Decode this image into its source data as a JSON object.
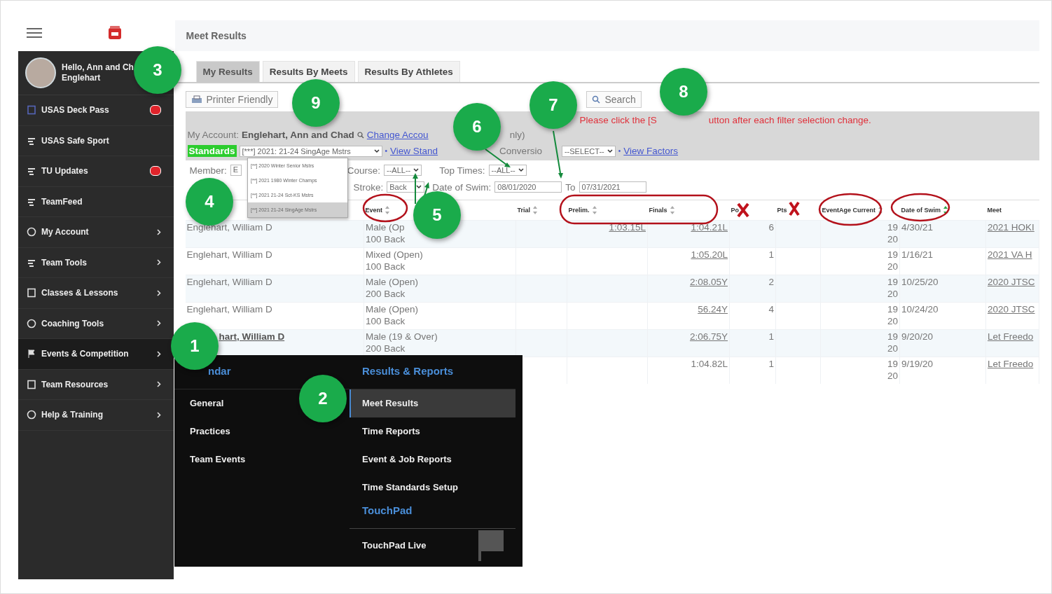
{
  "header": {
    "title": "Meet Results"
  },
  "user": {
    "greeting": "Hello, Ann and Ch",
    "name": "Englehart"
  },
  "sidebar": {
    "items": [
      {
        "label": "USAS Deck Pass",
        "badge": true,
        "submenu": false,
        "selected": false
      },
      {
        "label": "USAS Safe Sport",
        "badge": false,
        "submenu": false,
        "selected": false
      },
      {
        "label": "TU Updates",
        "badge": true,
        "submenu": false,
        "selected": false
      },
      {
        "label": "TeamFeed",
        "badge": false,
        "submenu": false,
        "selected": false
      },
      {
        "label": "My Account",
        "badge": false,
        "submenu": true,
        "selected": false
      },
      {
        "label": "Team Tools",
        "badge": false,
        "submenu": true,
        "selected": false
      },
      {
        "label": "Classes & Lessons",
        "badge": false,
        "submenu": true,
        "selected": false
      },
      {
        "label": "Coaching Tools",
        "badge": false,
        "submenu": true,
        "selected": false
      },
      {
        "label": "Events & Competition",
        "badge": false,
        "submenu": true,
        "selected": true
      },
      {
        "label": "Team Resources",
        "badge": false,
        "submenu": true,
        "selected": false
      },
      {
        "label": "Help & Training",
        "badge": false,
        "submenu": true,
        "selected": false
      }
    ]
  },
  "tabs": [
    {
      "label": "My Results",
      "selected": true
    },
    {
      "label": "Results By Meets",
      "selected": false
    },
    {
      "label": "Results By Athletes",
      "selected": false
    }
  ],
  "toolbar": {
    "printer": "Printer Friendly",
    "search": "Search"
  },
  "notice": [
    "Please click the [S",
    "utton after each filter selection change."
  ],
  "account": {
    "label": "My Account:",
    "name": "Englehart, Ann and Chad",
    "link": "Change Accou",
    "tail": "nly)"
  },
  "standards": {
    "label": "Standards",
    "value": "[***] 2021: 21-24 SingAge Mstrs",
    "link": "View Stand",
    "separators": [
      "•",
      "•"
    ],
    "conversion_label": "Conversio",
    "conversion_value": "--SELECT--",
    "factors_link": "View Factors",
    "options": [
      {
        "label": "[**] 2020 Winter Senior Mstrs",
        "selected": false
      },
      {
        "label": "[**] 2021 1980 Winter Champs",
        "selected": false
      },
      {
        "label": "[**] 2021 21-24 Sct-KS Mstrs",
        "selected": false
      },
      {
        "label": "[**] 2021 21-24 SingAge Mstrs",
        "selected": true
      }
    ]
  },
  "filters": {
    "member_label": "Member:",
    "member_value": "E",
    "course_label": "Course:",
    "course_value": "--ALL--",
    "top_label": "Top Times:",
    "top_value": "--ALL--",
    "stroke_label": "Stroke:",
    "stroke_value": "Back",
    "date_label": "Date of Swim:",
    "date_from": "08/01/2020",
    "to_label": "To",
    "date_to": "07/31/2021"
  },
  "table": {
    "columns": [
      {
        "label": "Event",
        "sortable": true,
        "sorted": false
      },
      {
        "label": "Trial",
        "sortable": true,
        "sorted": false
      },
      {
        "label": "Prelim.",
        "sortable": true,
        "sorted": false
      },
      {
        "label": "Finals",
        "sortable": true,
        "sorted": false
      },
      {
        "label": "Po",
        "sortable": false
      },
      {
        "label": "Pts",
        "sortable": false
      },
      {
        "label": "EventAge Current",
        "sortable": true,
        "sorted": false
      },
      {
        "label": "Date of Swim",
        "sortable": true,
        "sorted": true
      },
      {
        "label": "Meet",
        "sortable": false
      }
    ],
    "rows": [
      {
        "name": "Englehart, William D",
        "name_link": false,
        "event": [
          "Male (Op",
          "100 Back"
        ],
        "prelim": "1:03.15L",
        "finals": "1:04.21L",
        "finals_link": true,
        "place": "6",
        "event_age": "19",
        "current_age": "20",
        "date": "4/30/21",
        "meet": "2021 HOKI"
      },
      {
        "name": "Englehart, William D",
        "name_link": false,
        "event": [
          "Mixed (Open)",
          "100 Back"
        ],
        "finals": "1:05.20L",
        "finals_link": true,
        "place": "1",
        "event_age": "19",
        "current_age": "20",
        "date": "1/16/21",
        "meet": "2021 VA H"
      },
      {
        "name": "Englehart, William D",
        "name_link": false,
        "event": [
          "Male (Open)",
          "200 Back"
        ],
        "finals": "2:08.05Y",
        "finals_link": true,
        "place": "2",
        "event_age": "19",
        "current_age": "20",
        "date": "10/25/20",
        "meet": "2020 JTSC"
      },
      {
        "name": "Englehart, William D",
        "name_link": false,
        "event": [
          "Male (Open)",
          "100 Back"
        ],
        "finals": "56.24Y",
        "finals_link": true,
        "place": "4",
        "event_age": "19",
        "current_age": "20",
        "date": "10/24/20",
        "meet": "2020 JTSC"
      },
      {
        "name": "hart, William D",
        "name_link": true,
        "event": [
          "Male (19 & Over)",
          "200 Back"
        ],
        "finals": "2:06.75Y",
        "finals_link": true,
        "place": "1",
        "event_age": "19",
        "current_age": "20",
        "date": "9/20/20",
        "meet": "Let Freedo"
      },
      {
        "finals": "1:04.82L",
        "finals_link": false,
        "place": "1",
        "event_age": "19",
        "current_age": "20",
        "date": "9/19/20",
        "meet": "Let Freedo"
      }
    ]
  },
  "flyout": {
    "left": {
      "heading": "ndar",
      "items": [
        {
          "label": "General",
          "selected": false
        },
        {
          "label": "Practices",
          "selected": false
        },
        {
          "label": "Team Events",
          "selected": false
        }
      ]
    },
    "right": {
      "heading": "Results & Reports",
      "items": [
        {
          "label": "Meet Results",
          "selected": true
        },
        {
          "label": "Time Reports",
          "selected": false
        },
        {
          "label": "Event & Job Reports",
          "selected": false
        },
        {
          "label": "Time Standards Setup",
          "selected": false
        }
      ],
      "heading2": "TouchPad",
      "items2": [
        {
          "label": "TouchPad Live",
          "selected": false
        }
      ]
    }
  },
  "callouts": [
    "1",
    "2",
    "3",
    "4",
    "5",
    "6",
    "7",
    "8",
    "9"
  ]
}
